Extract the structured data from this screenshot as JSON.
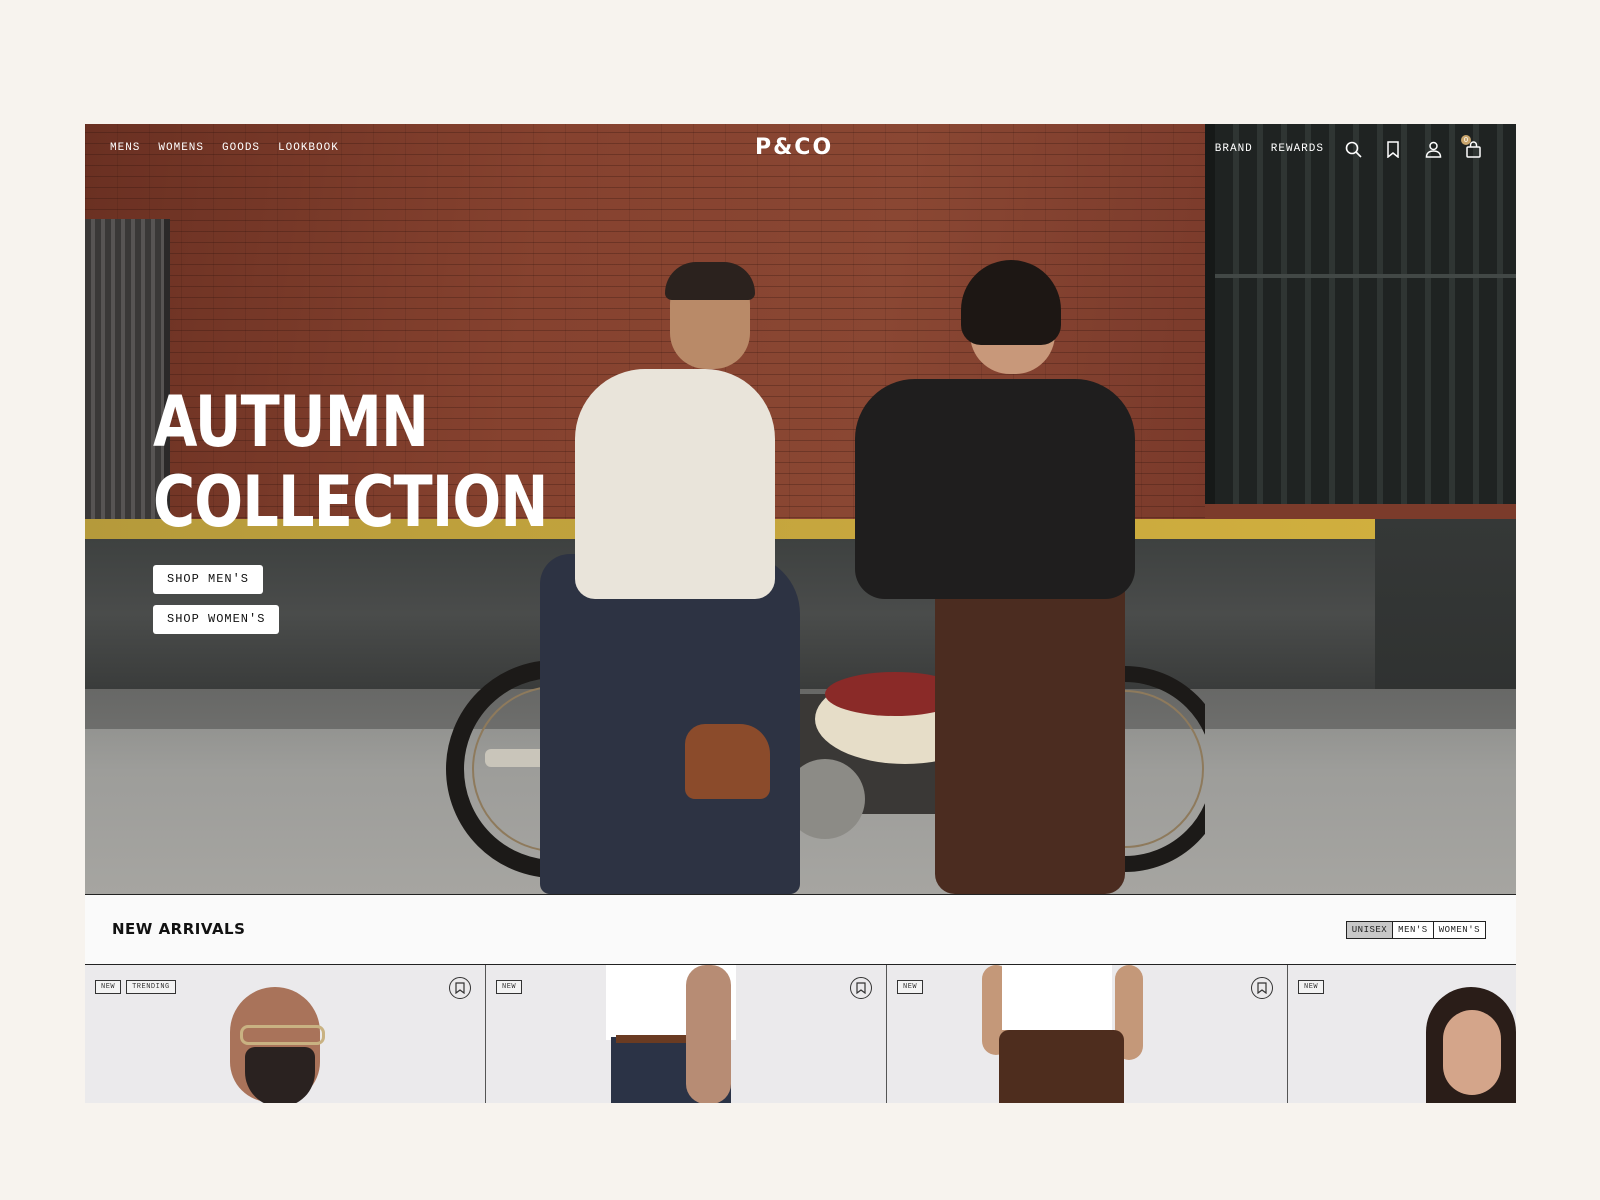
{
  "nav": {
    "left": [
      "MENS",
      "WOMENS",
      "GOODS",
      "LOOKBOOK"
    ],
    "logo": "P&CO",
    "right": [
      "BRAND",
      "REWARDS"
    ],
    "cart_count": "0",
    "icons": [
      "search-icon",
      "bookmark-icon",
      "account-icon",
      "cart-icon"
    ]
  },
  "hero": {
    "title_line1": "AUTUMN",
    "title_line2": "COLLECTION",
    "shop_mens": "SHOP MEN'S",
    "shop_womens": "SHOP WOMEN'S"
  },
  "arrivals": {
    "title": "NEW ARRIVALS",
    "filters": [
      "UNISEX",
      "MEN'S",
      "WOMEN'S"
    ],
    "active_filter": "UNISEX",
    "products": [
      {
        "tags": [
          "NEW",
          "TRENDING"
        ]
      },
      {
        "tags": [
          "NEW"
        ]
      },
      {
        "tags": [
          "NEW"
        ]
      },
      {
        "tags": [
          "NEW"
        ]
      }
    ]
  },
  "colors": {
    "page_bg": "#f7f3ee",
    "brick": "#7a3a2a",
    "accent_yellow": "#c9a83e",
    "text_dark": "#111111",
    "cart_badge": "#c9a56c"
  }
}
